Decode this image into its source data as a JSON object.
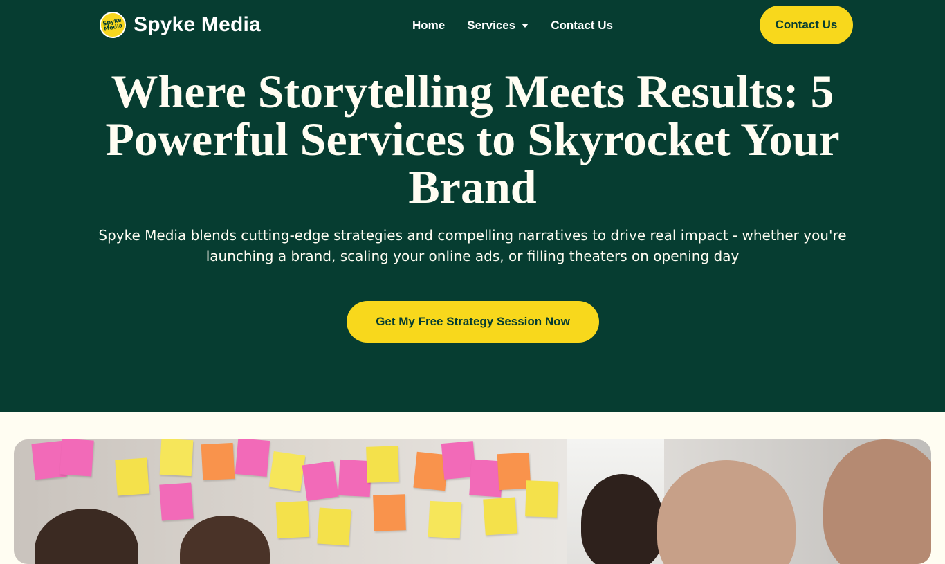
{
  "brand": {
    "name": "Spyke Media",
    "logo_badge_text": "Spyke Media",
    "accent_color": "#f8d81c",
    "primary_color": "#063d31",
    "background_color": "#fffdf2"
  },
  "nav": {
    "items": [
      {
        "label": "Home"
      },
      {
        "label": "Services",
        "has_dropdown": true,
        "icon": "caret-down-icon"
      },
      {
        "label": "Contact Us"
      }
    ],
    "cta_label": "Contact Us"
  },
  "hero": {
    "headline": "Where Storytelling Meets Results: 5 Powerful Services to Skyrocket Your Brand",
    "subtext": "Spyke Media blends cutting-edge strategies and compelling narratives to drive real impact - whether you're launching a brand, scaling your online ads, or filling theaters on opening day",
    "cta_label": "Get My Free Strategy Session Now"
  },
  "media": {
    "image_description_icon": "team-brainstorm-photo"
  }
}
